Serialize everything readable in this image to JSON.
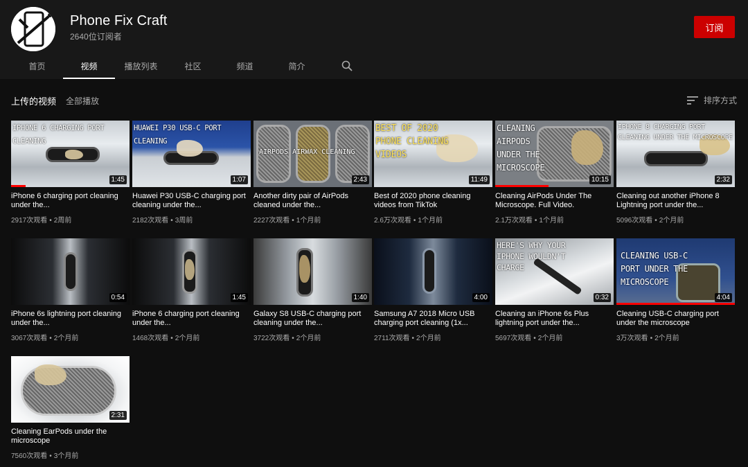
{
  "channel": {
    "name": "Phone Fix Craft",
    "subscribers": "2640位订阅者",
    "subscribe_label": "订阅"
  },
  "tabs": [
    {
      "label": "首页",
      "active": false
    },
    {
      "label": "视频",
      "active": true
    },
    {
      "label": "播放列表",
      "active": false
    },
    {
      "label": "社区",
      "active": false
    },
    {
      "label": "频道",
      "active": false
    },
    {
      "label": "简介",
      "active": false
    }
  ],
  "section": {
    "title": "上传的视频",
    "play_all": "全部播放",
    "sort_label": "排序方式"
  },
  "icons": {
    "search": "search-icon",
    "sort": "sort-icon"
  },
  "colors": {
    "subscribe": "#cc0000",
    "progress": "#ff0000",
    "background": "#0f0f0f",
    "header": "#181818"
  },
  "videos": [
    {
      "title": "iPhone 6 charging port cleaning under the...",
      "views": "2917次观看",
      "age": "2周前",
      "duration": "1:45",
      "thumb_text": "IPHONE 6 CHARGING PORT CLEANING",
      "watched": 0.12
    },
    {
      "title": "Huawei P30 USB-C charging port cleaning under the...",
      "views": "2182次观看",
      "age": "3周前",
      "duration": "1:07",
      "thumb_text": "HUAWEI P30 USB-C PORT CLEANING",
      "watched": 0
    },
    {
      "title": "Another dirty pair of AirPods cleaned under the...",
      "views": "2227次观看",
      "age": "1个月前",
      "duration": "2:43",
      "thumb_text": "AIRPODS   AIRWAX   CLEANING",
      "watched": 0
    },
    {
      "title": "Best of 2020 phone cleaning videos from TikTok",
      "views": "2.6万次观看",
      "age": "1个月前",
      "duration": "11:49",
      "thumb_text": "BEST OF 2020 PHONE CLEANING VIDEOS",
      "watched": 0
    },
    {
      "title": "Cleaning AirPods Under The Microscope. Full Video.",
      "views": "2.1万次观看",
      "age": "1个月前",
      "duration": "10:15",
      "thumb_text": "CLEANING AIRPODS UNDER THE MICROSCOPE",
      "watched": 0.45
    },
    {
      "title": "Cleaning out another iPhone 8 Lightning port under the...",
      "views": "5096次观看",
      "age": "2个月前",
      "duration": "2:32",
      "thumb_text": "IPHONE 8 CHARGING PORT CLEANING UNDER THE MICROSCOPE",
      "watched": 0
    },
    {
      "title": "iPhone 6s lightning port cleaning under the...",
      "views": "3067次观看",
      "age": "2个月前",
      "duration": "0:54",
      "thumb_text": "",
      "watched": 0
    },
    {
      "title": "iPhone 6 charging port cleaning under the...",
      "views": "1468次观看",
      "age": "2个月前",
      "duration": "1:45",
      "thumb_text": "",
      "watched": 0
    },
    {
      "title": "Galaxy S8 USB-C charging port cleaning under the...",
      "views": "3722次观看",
      "age": "2个月前",
      "duration": "1:40",
      "thumb_text": "",
      "watched": 0
    },
    {
      "title": "Samsung A7 2018 Micro USB charging port cleaning (1x...",
      "views": "2711次观看",
      "age": "2个月前",
      "duration": "4:00",
      "thumb_text": "",
      "watched": 0
    },
    {
      "title": "Cleaning an iPhone 6s Plus lightning port under the...",
      "views": "5697次观看",
      "age": "2个月前",
      "duration": "0:32",
      "thumb_text": "HERE'S WHY YOUR IPHONE WOULDN'T CHARGE",
      "watched": 0
    },
    {
      "title": "Cleaning USB-C charging port under the microscope",
      "views": "3万次观看",
      "age": "2个月前",
      "duration": "4:04",
      "thumb_text": "CLEANING USB-C PORT UNDER THE MICROSCOPE",
      "watched": 1.0
    },
    {
      "title": "Cleaning EarPods under the microscope",
      "views": "7560次观看",
      "age": "3个月前",
      "duration": "2:31",
      "thumb_text": "",
      "watched": 0
    }
  ]
}
